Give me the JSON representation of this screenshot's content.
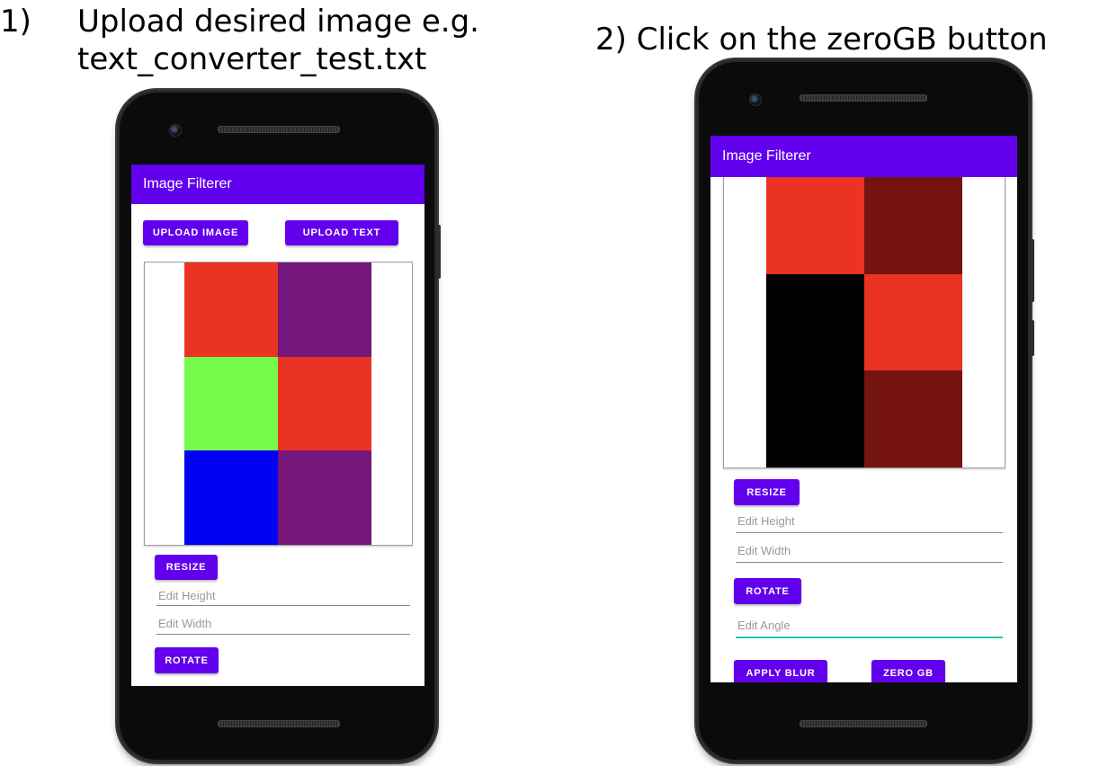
{
  "captions": {
    "step1_number": "1)",
    "step1_line1": "Upload desired image e.g.",
    "step1_line2": "text_converter_test.txt",
    "step2": "2) Click on the zeroGB button"
  },
  "phone1": {
    "app_title": "Image Filterer",
    "upload_image_label": "UPLOAD IMAGE",
    "upload_text_label": "UPLOAD TEXT",
    "resize_label": "RESIZE",
    "edit_height_placeholder": "Edit Height",
    "edit_width_placeholder": "Edit Width",
    "rotate_label": "ROTATE",
    "image_grid": {
      "columns": 2,
      "rows": 3,
      "colors": [
        "#ea3323",
        "#75167a",
        "#75fb4c",
        "#ea3323",
        "#0000f5",
        "#75167a"
      ]
    }
  },
  "phone2": {
    "app_title": "Image Filterer",
    "resize_label": "RESIZE",
    "edit_height_placeholder": "Edit Height",
    "edit_width_placeholder": "Edit Width",
    "rotate_label": "ROTATE",
    "edit_angle_placeholder": "Edit Angle",
    "apply_blur_label": "APPLY BLUR",
    "zero_gb_label": "ZERO GB",
    "image_grid": {
      "columns": 2,
      "rows": 3,
      "colors": [
        "#ea3323",
        "#75140f",
        "#000000",
        "#ea3323",
        "#000000",
        "#75140f"
      ]
    }
  },
  "colors": {
    "accent": "#6200ee",
    "focus_underline": "#26c6a8"
  }
}
